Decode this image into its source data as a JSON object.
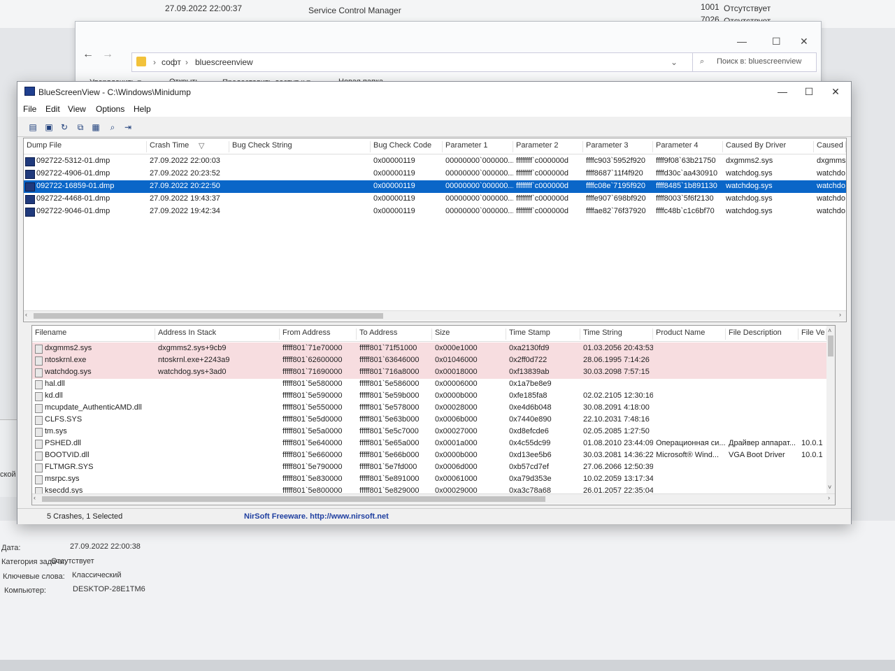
{
  "background": {
    "top_rows": [
      {
        "date": "27.09.2022 22:00:37",
        "source": "Service Control Manager",
        "id": "1001",
        "category": "Отсутствует"
      },
      {
        "date": "",
        "source": "",
        "id": "7026",
        "category": "Отсутствует"
      }
    ],
    "left_snippet": "ской ошибк",
    "details": [
      {
        "label": "Дата:",
        "value": "27.09.2022 22:00:38"
      },
      {
        "label": "Категория задачи:",
        "value": "Отсутствует"
      },
      {
        "label": "Ключевые слова:",
        "value": "Классический"
      },
      {
        "label": "Компьютер:",
        "value": "DESKTOP-28E1TM6"
      }
    ]
  },
  "explorer": {
    "breadcrumb": [
      "софт",
      "bluescreenview"
    ],
    "search_placeholder": "Поиск в: bluescreenview",
    "commands": [
      "Упорядочить ▾",
      "Открыть",
      "Предоставить доступ к ▾",
      "Новая папка"
    ],
    "controls": {
      "min": "—",
      "max": "☐",
      "close": "✕"
    }
  },
  "window": {
    "title": "BlueScreenView - C:\\Windows\\Minidump",
    "controls": {
      "min": "—",
      "max": "☐",
      "close": "✕"
    }
  },
  "menu": [
    "File",
    "Edit",
    "View",
    "Options",
    "Help"
  ],
  "toolbar_icons": [
    "properties-icon",
    "save-icon",
    "refresh-icon",
    "copy-icon",
    "html-report-icon",
    "find-icon",
    "exit-icon"
  ],
  "crashes": {
    "columns": [
      "Dump File",
      "Crash Time",
      "Bug Check String",
      "Bug Check Code",
      "Parameter 1",
      "Parameter 2",
      "Parameter 3",
      "Parameter 4",
      "Caused By Driver",
      "Caused By Address"
    ],
    "sort_indicator": "▽",
    "selected_index": 2,
    "rows": [
      [
        "092722-5312-01.dmp",
        "27.09.2022 22:00:03",
        "",
        "0x00000119",
        "00000000`000000...",
        "ffffffff`c000000d",
        "ffffc903`5952f920",
        "ffff9f08`63b21750",
        "dxgmms2.sys",
        "dxgmms"
      ],
      [
        "092722-4906-01.dmp",
        "27.09.2022 20:23:52",
        "",
        "0x00000119",
        "00000000`000000...",
        "ffffffff`c000000d",
        "ffff8687`11f4f920",
        "ffffd30c`aa430910",
        "watchdog.sys",
        "watchdo"
      ],
      [
        "092722-16859-01.dmp",
        "27.09.2022 20:22:50",
        "",
        "0x00000119",
        "00000000`000000...",
        "ffffffff`c000000d",
        "ffffc08e`7195f920",
        "ffff8485`1b891130",
        "watchdog.sys",
        "watchdo"
      ],
      [
        "092722-4468-01.dmp",
        "27.09.2022 19:43:37",
        "",
        "0x00000119",
        "00000000`000000...",
        "ffffffff`c000000d",
        "ffffe907`698bf920",
        "ffff8003`5f6f2130",
        "watchdog.sys",
        "watchdo"
      ],
      [
        "092722-9046-01.dmp",
        "27.09.2022 19:42:34",
        "",
        "0x00000119",
        "00000000`000000...",
        "ffffffff`c000000d",
        "ffffae82`76f37920",
        "ffffc48b`c1c6bf70",
        "watchdog.sys",
        "watchdo"
      ]
    ]
  },
  "drivers": {
    "columns": [
      "Filename",
      "Address In Stack",
      "From Address",
      "To Address",
      "Size",
      "Time Stamp",
      "Time String",
      "Product Name",
      "File Description",
      "File Ve"
    ],
    "rows": [
      [
        "dxgmms2.sys",
        "dxgmms2.sys+9cb9",
        "fffff801`71e70000",
        "fffff801`71f51000",
        "0x000e1000",
        "0xa2130fd9",
        "01.03.2056 20:43:53",
        "",
        "",
        ""
      ],
      [
        "ntoskrnl.exe",
        "ntoskrnl.exe+2243a9",
        "fffff801`62600000",
        "fffff801`63646000",
        "0x01046000",
        "0x2ff0d722",
        "28.06.1995 7:14:26",
        "",
        "",
        ""
      ],
      [
        "watchdog.sys",
        "watchdog.sys+3ad0",
        "fffff801`71690000",
        "fffff801`716a8000",
        "0x00018000",
        "0xf13839ab",
        "30.03.2098 7:57:15",
        "",
        "",
        ""
      ],
      [
        "hal.dll",
        "",
        "fffff801`5e580000",
        "fffff801`5e586000",
        "0x00006000",
        "0x1a7be8e9",
        "",
        "",
        "",
        ""
      ],
      [
        "kd.dll",
        "",
        "fffff801`5e590000",
        "fffff801`5e59b000",
        "0x0000b000",
        "0xfe185fa8",
        "02.02.2105 12:30:16",
        "",
        "",
        ""
      ],
      [
        "mcupdate_AuthenticAMD.dll",
        "",
        "fffff801`5e550000",
        "fffff801`5e578000",
        "0x00028000",
        "0xe4d6b048",
        "30.08.2091 4:18:00",
        "",
        "",
        ""
      ],
      [
        "CLFS.SYS",
        "",
        "fffff801`5e5d0000",
        "fffff801`5e63b000",
        "0x0006b000",
        "0x7440e890",
        "22.10.2031 7:48:16",
        "",
        "",
        ""
      ],
      [
        "tm.sys",
        "",
        "fffff801`5e5a0000",
        "fffff801`5e5c7000",
        "0x00027000",
        "0xd8efcde6",
        "02.05.2085 1:27:50",
        "",
        "",
        ""
      ],
      [
        "PSHED.dll",
        "",
        "fffff801`5e640000",
        "fffff801`5e65a000",
        "0x0001a000",
        "0x4c55dc99",
        "01.08.2010 23:44:09",
        "Операционная си...",
        "Драйвер аппарат...",
        "10.0.1"
      ],
      [
        "BOOTVID.dll",
        "",
        "fffff801`5e660000",
        "fffff801`5e66b000",
        "0x0000b000",
        "0xd13ee5b6",
        "30.03.2081 14:36:22",
        "Microsoft® Wind...",
        "VGA Boot Driver",
        "10.0.1"
      ],
      [
        "FLTMGR.SYS",
        "",
        "fffff801`5e790000",
        "fffff801`5e7fd000",
        "0x0006d000",
        "0xb57cd7ef",
        "27.06.2066 12:50:39",
        "",
        "",
        ""
      ],
      [
        "msrpc.sys",
        "",
        "fffff801`5e830000",
        "fffff801`5e891000",
        "0x00061000",
        "0xa79d353e",
        "10.02.2059 13:17:34",
        "",
        "",
        ""
      ],
      [
        "ksecdd.sys",
        "",
        "fffff801`5e800000",
        "fffff801`5e829000",
        "0x00029000",
        "0xa3c78a68",
        "26.01.2057 22:35:04",
        "",
        "",
        ""
      ]
    ]
  },
  "status": {
    "summary": "5 Crashes, 1 Selected",
    "link": "NirSoft Freeware.  http://www.nirsoft.net"
  },
  "colors": {
    "selection": "#0a66c8",
    "error_row": "#f7dde0",
    "link": "#1f3fa0"
  }
}
